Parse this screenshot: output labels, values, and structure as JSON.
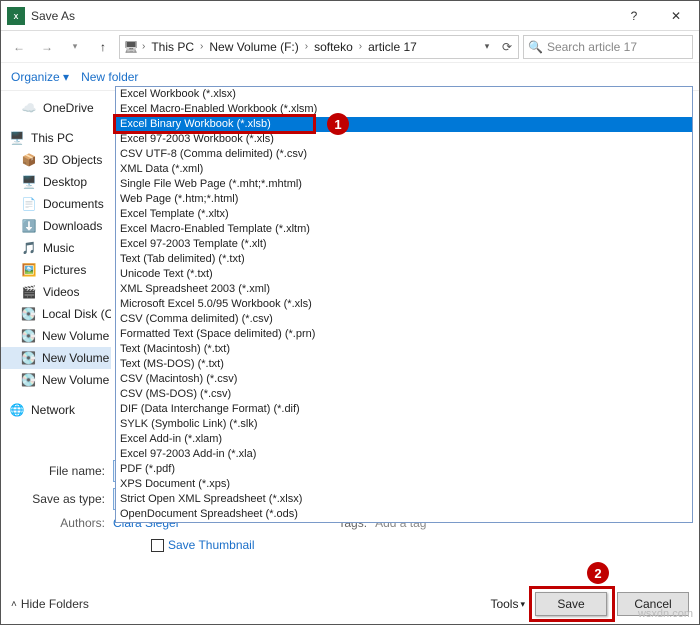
{
  "window": {
    "title": "Save As"
  },
  "breadcrumb": {
    "segs": [
      "This PC",
      "New Volume (F:)",
      "softeko",
      "article 17"
    ]
  },
  "search": {
    "placeholder": "Search article 17"
  },
  "toolbar": {
    "organize": "Organize",
    "newfolder": "New folder"
  },
  "sidebar": {
    "items": [
      {
        "label": "OneDrive",
        "ic": "cloud"
      },
      {
        "label": "This PC",
        "ic": "pc",
        "hdr": true
      },
      {
        "label": "3D Objects",
        "ic": "3d"
      },
      {
        "label": "Desktop",
        "ic": "desk"
      },
      {
        "label": "Documents",
        "ic": "doc"
      },
      {
        "label": "Downloads",
        "ic": "dl"
      },
      {
        "label": "Music",
        "ic": "mus"
      },
      {
        "label": "Pictures",
        "ic": "pic"
      },
      {
        "label": "Videos",
        "ic": "vid"
      },
      {
        "label": "Local Disk (C:)",
        "ic": "disk"
      },
      {
        "label": "New Volume (D:)",
        "ic": "disk"
      },
      {
        "label": "New Volume (E:)",
        "ic": "disk",
        "sel": true
      },
      {
        "label": "New Volume (F:)",
        "ic": "disk"
      },
      {
        "label": "Network",
        "ic": "net",
        "hdr": true
      }
    ]
  },
  "filetypes": [
    "Excel Workbook (*.xlsx)",
    "Excel Macro-Enabled Workbook (*.xlsm)",
    "Excel Binary Workbook (*.xlsb)",
    "Excel 97-2003 Workbook (*.xls)",
    "CSV UTF-8 (Comma delimited) (*.csv)",
    "XML Data (*.xml)",
    "Single File Web Page (*.mht;*.mhtml)",
    "Web Page (*.htm;*.html)",
    "Excel Template (*.xltx)",
    "Excel Macro-Enabled Template (*.xltm)",
    "Excel 97-2003 Template (*.xlt)",
    "Text (Tab delimited) (*.txt)",
    "Unicode Text (*.txt)",
    "XML Spreadsheet 2003 (*.xml)",
    "Microsoft Excel 5.0/95 Workbook (*.xls)",
    "CSV (Comma delimited) (*.csv)",
    "Formatted Text (Space delimited) (*.prn)",
    "Text (Macintosh) (*.txt)",
    "Text (MS-DOS) (*.txt)",
    "CSV (Macintosh) (*.csv)",
    "CSV (MS-DOS) (*.csv)",
    "DIF (Data Interchange Format) (*.dif)",
    "SYLK (Symbolic Link) (*.slk)",
    "Excel Add-in (*.xlam)",
    "Excel 97-2003 Add-in (*.xla)",
    "PDF (*.pdf)",
    "XPS Document (*.xps)",
    "Strict Open XML Spreadsheet (*.xlsx)",
    "OpenDocument Spreadsheet (*.ods)"
  ],
  "form": {
    "filename_label": "File name:",
    "filename_value": "",
    "type_label": "Save as type:",
    "type_value": "Excel Binary Workbook (*.xlsb)",
    "authors_label": "Authors:",
    "authors_value": "Clara Siegel",
    "tags_label": "Tags:",
    "tags_value": "Add a tag",
    "thumb": "Save Thumbnail"
  },
  "footer": {
    "hide": "Hide Folders",
    "tools": "Tools",
    "save": "Save",
    "cancel": "Cancel"
  },
  "watermark": "wsxdn.com"
}
